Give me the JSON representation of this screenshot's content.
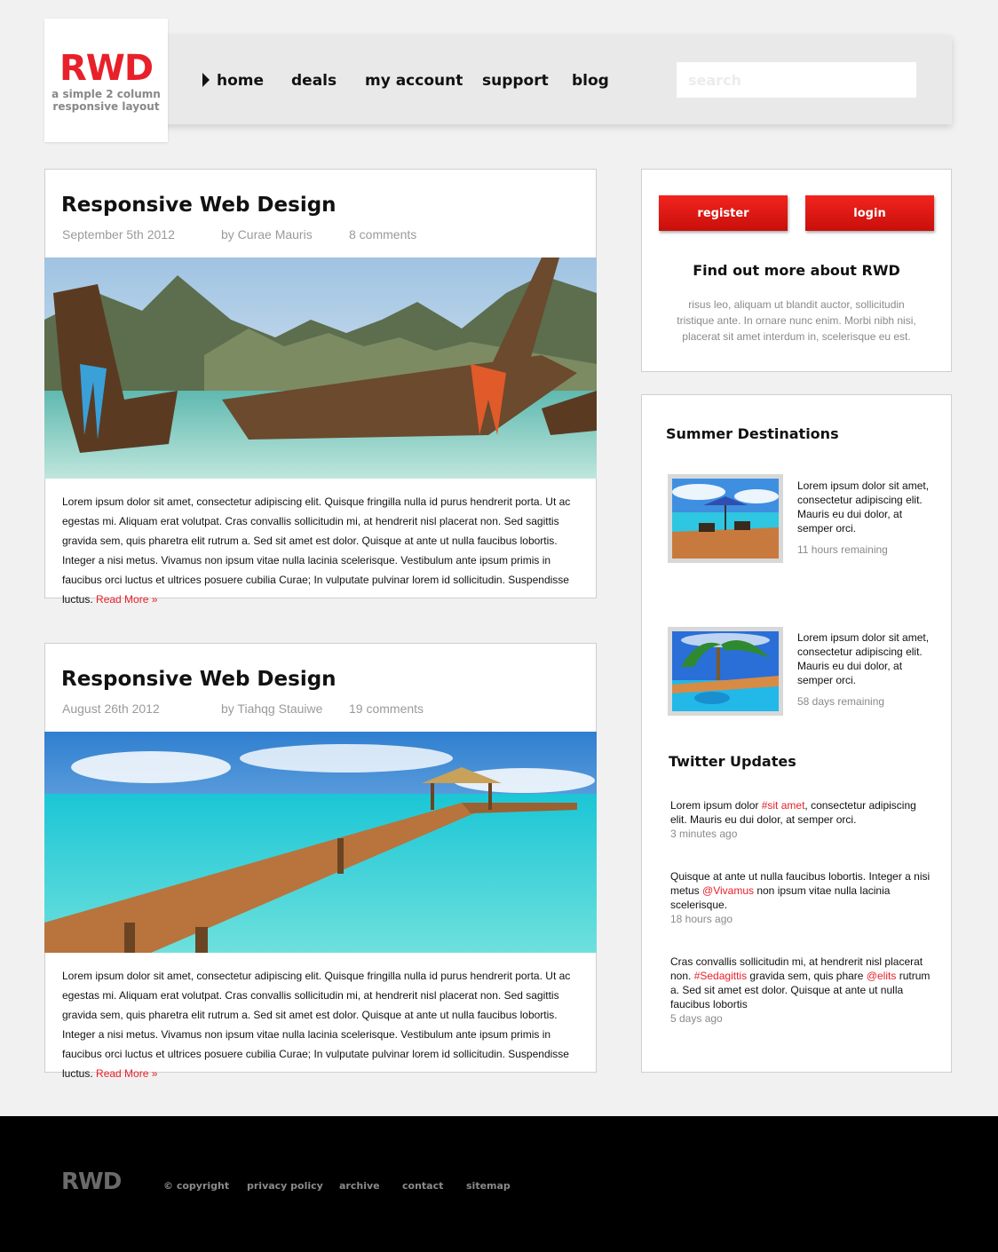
{
  "logo": {
    "text": "RWD",
    "tagline_line1": "a simple 2 column",
    "tagline_line2": "responsive layout"
  },
  "nav": {
    "items": [
      {
        "label": "home",
        "active": true
      },
      {
        "label": "deals"
      },
      {
        "label": "my account"
      },
      {
        "label": "support"
      },
      {
        "label": "blog"
      }
    ]
  },
  "search": {
    "placeholder": "search"
  },
  "posts": [
    {
      "title": "Responsive Web Design",
      "date": "September 5th 2012",
      "author": "by Curae Mauris",
      "comments": "8 comments",
      "body": "Lorem ipsum dolor sit amet, consectetur adipiscing elit. Quisque fringilla nulla id purus hendrerit porta. Ut ac egestas mi. Aliquam erat volutpat. Cras convallis sollicitudin mi, at hendrerit nisl placerat non. Sed sagittis gravida sem, quis pharetra elit rutrum a. Sed sit amet est dolor. Quisque at ante ut nulla faucibus lobortis. Integer a nisi metus. Vivamus non ipsum vitae nulla lacinia scelerisque. Vestibulum ante ipsum primis in faucibus orci luctus et ultrices posuere cubilia Curae; In vulputate pulvinar lorem id sollicitudin. Suspendisse luctus.",
      "read_more": "Read More »"
    },
    {
      "title": "Responsive Web Design",
      "date": "August 26th 2012",
      "author": "by Tiahqg Stauiwe",
      "comments": "19 comments",
      "body": "Lorem ipsum dolor sit amet, consectetur adipiscing elit. Quisque fringilla nulla id purus hendrerit porta. Ut ac egestas mi. Aliquam erat volutpat. Cras convallis sollicitudin mi, at hendrerit nisl placerat non. Sed sagittis gravida sem, quis pharetra elit rutrum a. Sed sit amet est dolor. Quisque at ante ut nulla faucibus lobortis. Integer a nisi metus. Vivamus non ipsum vitae nulla lacinia scelerisque. Vestibulum ante ipsum primis in faucibus orci luctus et ultrices posuere cubilia Curae; In vulputate pulvinar lorem id sollicitudin. Suspendisse luctus.",
      "read_more": "Read More »"
    }
  ],
  "sidebar": {
    "register_label": "register",
    "login_label": "login",
    "about_heading": "Find out more about RWD",
    "about_text": "risus leo, aliquam ut blandit auctor, sollicitudin tristique ante. In ornare nunc enim. Morbi nibh nisi, placerat sit amet interdum in, scelerisque eu est.",
    "destinations_heading": "Summer Destinations",
    "destinations": [
      {
        "text": "Lorem ipsum dolor sit amet, consectetur adipiscing elit. Mauris eu dui dolor, at semper orci.",
        "time": "11 hours remaining"
      },
      {
        "text": "Lorem ipsum dolor sit amet, consectetur adipiscing elit. Mauris eu dui dolor, at semper orci.",
        "time": "58 days remaining"
      }
    ],
    "twitter_heading": "Twitter Updates",
    "tweets": [
      {
        "pre": "Lorem ipsum dolor ",
        "tag": "#sit amet",
        "post": ", consectetur adipiscing elit. Mauris eu dui dolor, at semper orci.",
        "time": "3 minutes ago"
      },
      {
        "pre": "Quisque at ante ut nulla faucibus lobortis. Integer a nisi metus ",
        "tag": "@Vivamus",
        "post": " non ipsum vitae nulla lacinia scelerisque.",
        "time": "18 hours ago"
      },
      {
        "pre": "Cras convallis sollicitudin mi, at hendrerit nisl placerat non. ",
        "tag": "#Sedagittis",
        "post": " gravida sem, quis phare ",
        "tag2": "@elits",
        "post2": " rutrum a. Sed sit amet est dolor. Quisque at ante ut nulla faucibus lobortis",
        "time": "5 days ago"
      }
    ]
  },
  "footer": {
    "logo": "RWD",
    "links": [
      "© copyright",
      "privacy policy",
      "archive",
      "contact",
      "sitemap"
    ]
  },
  "colors": {
    "accent": "#e8202a",
    "background": "#f1f1f1",
    "footer": "#000000"
  }
}
